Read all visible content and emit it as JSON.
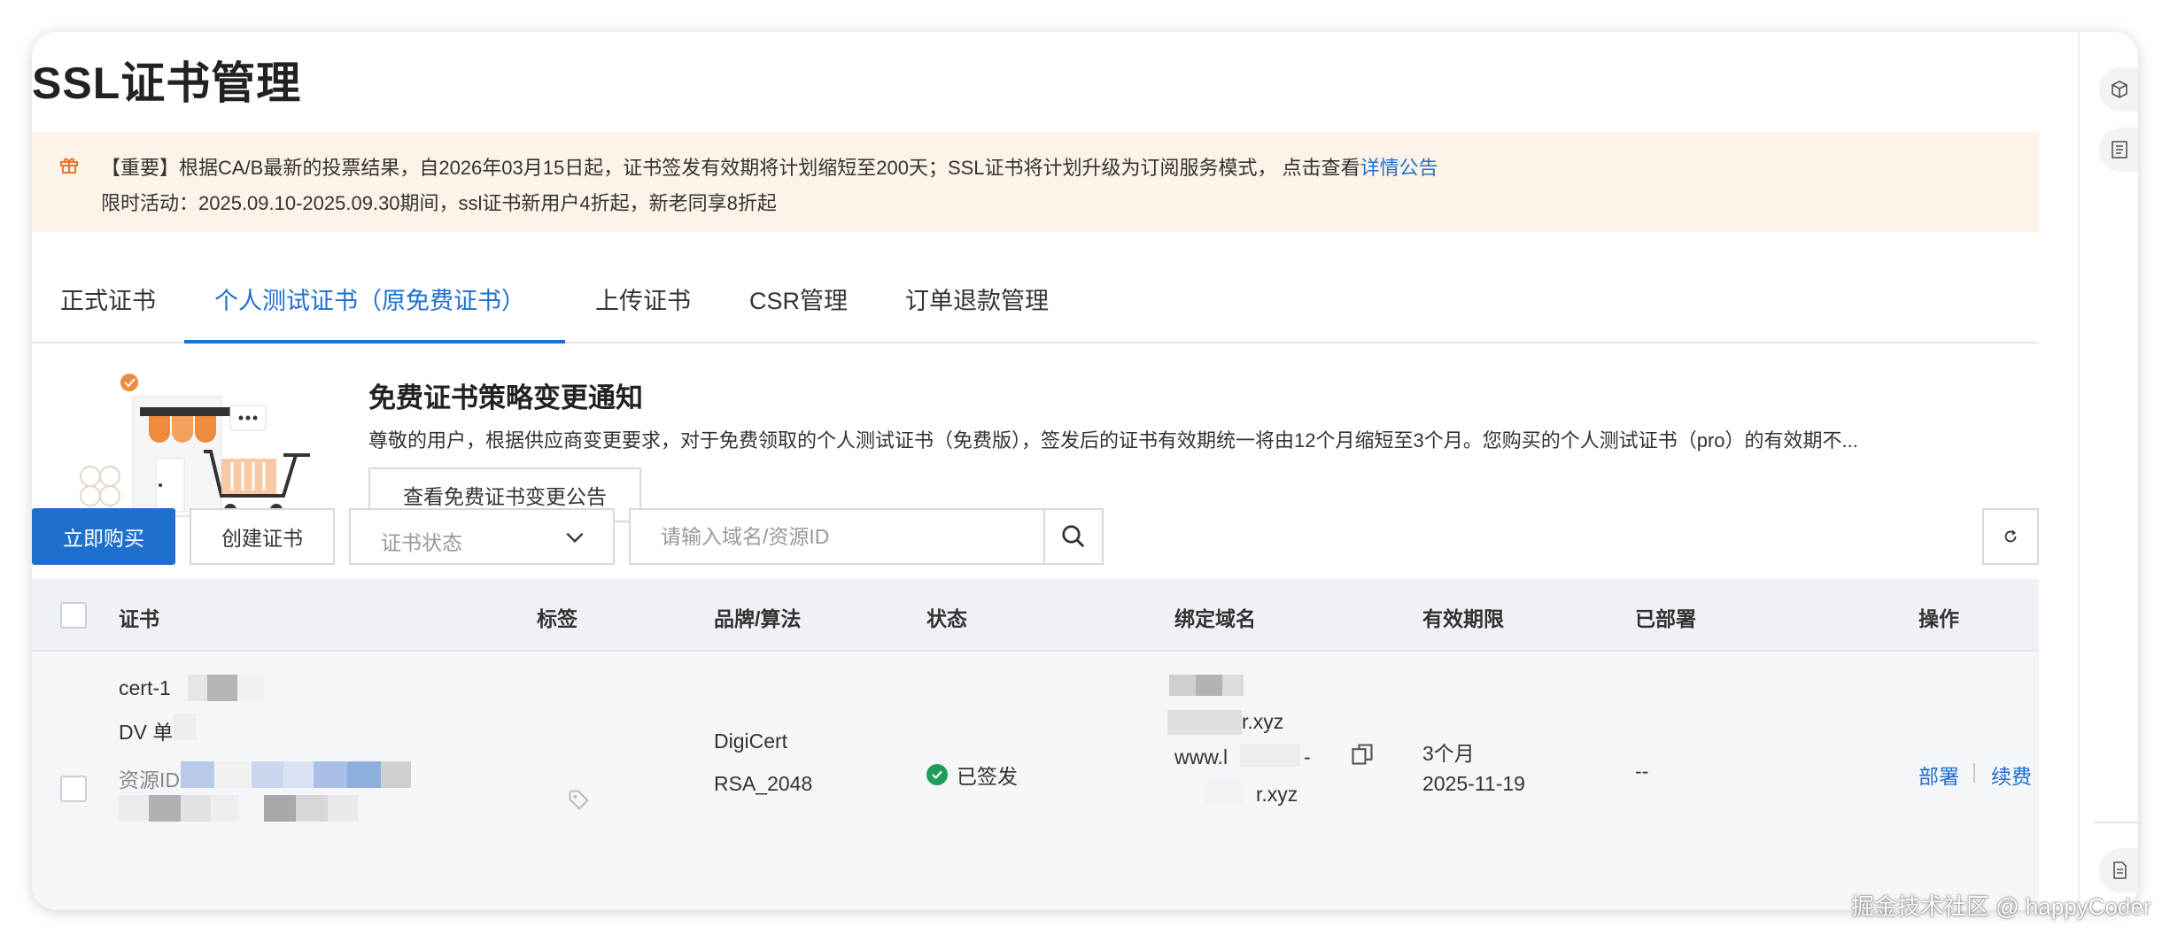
{
  "page": {
    "title": "SSL证书管理"
  },
  "notice": {
    "icon": "gift-icon",
    "line1_text": "【重要】根据CA/B最新的投票结果，自2026年03月15日起，证书签发有效期将计划缩短至200天；SSL证书将计划升级为订阅服务模式， 点击查看",
    "line1_link": "详情公告",
    "line2_text": "限时活动：2025.09.10-2025.09.30期间，ssl证书新用户4折起，新老同享8折起",
    "colors": {
      "background": "#fdf3e8",
      "icon": "#e8772e",
      "link": "#1f6fcf"
    }
  },
  "tabs": [
    {
      "label": "正式证书",
      "active": false
    },
    {
      "label": "个人测试证书（原免费证书）",
      "active": true
    },
    {
      "label": "上传证书",
      "active": false
    },
    {
      "label": "CSR管理",
      "active": false
    },
    {
      "label": "订单退款管理",
      "active": false
    }
  ],
  "promo": {
    "title": "免费证书策略变更通知",
    "description": "尊敬的用户，根据供应商变更要求，对于免费领取的个人测试证书（免费版），签发后的证书有效期统一将由12个月缩短至3个月。您购买的个人测试证书（pro）的有效期不...",
    "button_label": "查看免费证书变更公告",
    "illustration": "shop-cart-illustration"
  },
  "toolbar": {
    "buy_label": "立即购买",
    "create_label": "创建证书",
    "status_select_placeholder": "证书状态",
    "search_placeholder": "请输入域名/资源ID",
    "search_value": "",
    "icons": {
      "chevron": "chevron-down-icon",
      "search": "search-icon",
      "refresh": "refresh-icon"
    }
  },
  "table": {
    "columns": [
      "证书",
      "标签",
      "品牌/算法",
      "状态",
      "绑定域名",
      "有效期限",
      "已部署",
      "操作"
    ],
    "rows": [
      {
        "cert_name": "cert-1",
        "cert_type": "DV 单",
        "resource_id_label": "资源ID",
        "tag_icon": "tag-icon",
        "brand": "DigiCert",
        "algorithm": "RSA_2048",
        "status": "已签发",
        "domain_line1": "r.xyz",
        "domain_line2": "www.l",
        "domain_line2_suffix": "-",
        "domain_line3": "r.xyz",
        "validity": "3个月",
        "expiry": "2025-11-19",
        "deployed": "--",
        "actions": [
          "部署",
          "续费"
        ]
      }
    ]
  },
  "right_rail": {
    "icons": [
      "cube-icon",
      "list-icon",
      "document-icon"
    ]
  },
  "watermark": "掘金技术社区 @ happyCoder",
  "colors": {
    "accent": "#1f6fcf",
    "success": "#1e9e5a",
    "table_header_bg": "#eef1f6",
    "row_bg": "#f4f6f9"
  }
}
